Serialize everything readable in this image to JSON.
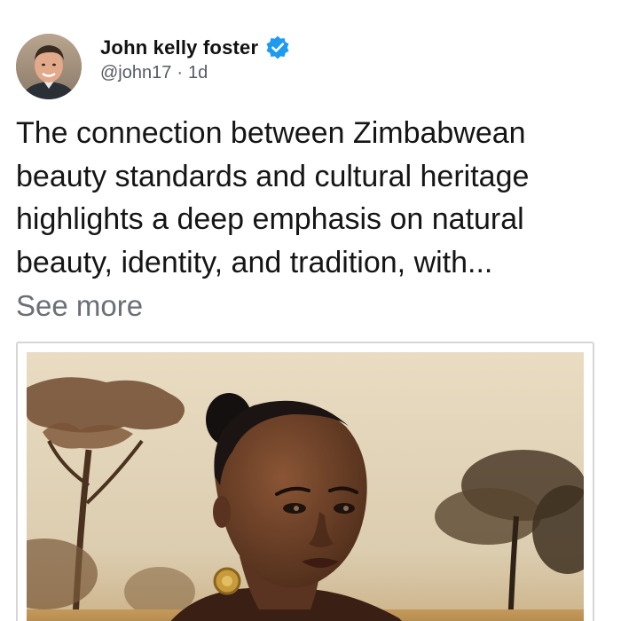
{
  "post": {
    "author": {
      "display_name": "John kelly foster",
      "handle": "@john17",
      "separator": "·",
      "time": "1d",
      "verified": true,
      "verified_color": "#1d9bf0"
    },
    "text": "The connection between Zimbabwean beauty standards and cultural heritage highlights a deep emphasis on natural beauty, identity, and tradition, with...",
    "see_more": "See more",
    "media": {
      "icon": "photo-of-woman-in-savanna"
    }
  }
}
